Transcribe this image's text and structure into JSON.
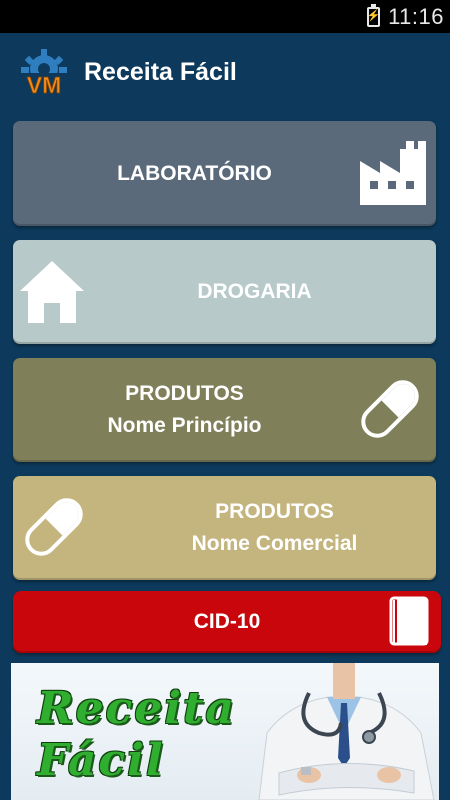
{
  "status_bar": {
    "time": "11:16"
  },
  "header": {
    "title": "Receita Fácil",
    "logo_text": "VM"
  },
  "menu": {
    "laboratorio": {
      "label": "LABORATÓRIO",
      "icon": "factory-icon"
    },
    "drogaria": {
      "label": "DROGARIA",
      "icon": "house-icon"
    },
    "produtos_principio": {
      "line1": "PRODUTOS",
      "line2": "Nome Princípio",
      "icon": "pill-icon"
    },
    "produtos_comercial": {
      "line1": "PRODUTOS",
      "line2": "Nome Comercial",
      "icon": "pill-icon"
    },
    "cid10": {
      "label": "CID-10",
      "icon": "book-icon"
    }
  },
  "banner": {
    "line1": "Receita",
    "line2": "Fácil"
  },
  "colors": {
    "background": "#0d3a5c",
    "laboratorio": "#5a6a7b",
    "drogaria": "#b7c9c9",
    "produtos_principio": "#7f7f5a",
    "produtos_comercial": "#c4b57f",
    "cid10": "#c8060b"
  }
}
